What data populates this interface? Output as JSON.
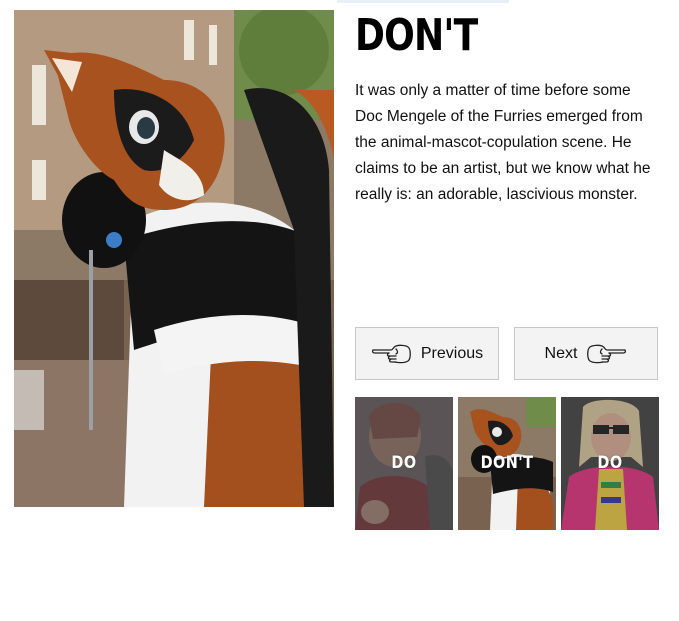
{
  "article": {
    "verdict": "DON'T",
    "description": "It was only a matter of time before some Doc Mengele of the Furries emerged from the animal-mascot-copulation scene. He claims to be an artist, but we know what he really is: an adorable, lascivious monster.",
    "main_photo_icon": "furry-mascot-photo"
  },
  "navigation": {
    "previous_label": "Previous",
    "next_label": "Next",
    "previous_icon": "pointing-hand-left-icon",
    "next_icon": "pointing-hand-right-icon"
  },
  "thumbnails": [
    {
      "label": "DO",
      "icon": "woman-photo"
    },
    {
      "label": "DON'T",
      "icon": "furry-mascot-photo"
    },
    {
      "label": "DO",
      "icon": "woman-glasses-photo"
    }
  ],
  "colors": {
    "nav_button_bg": "#f3f3f3",
    "nav_button_border": "#c9c9c9",
    "thumb_overlay": "#555555"
  }
}
